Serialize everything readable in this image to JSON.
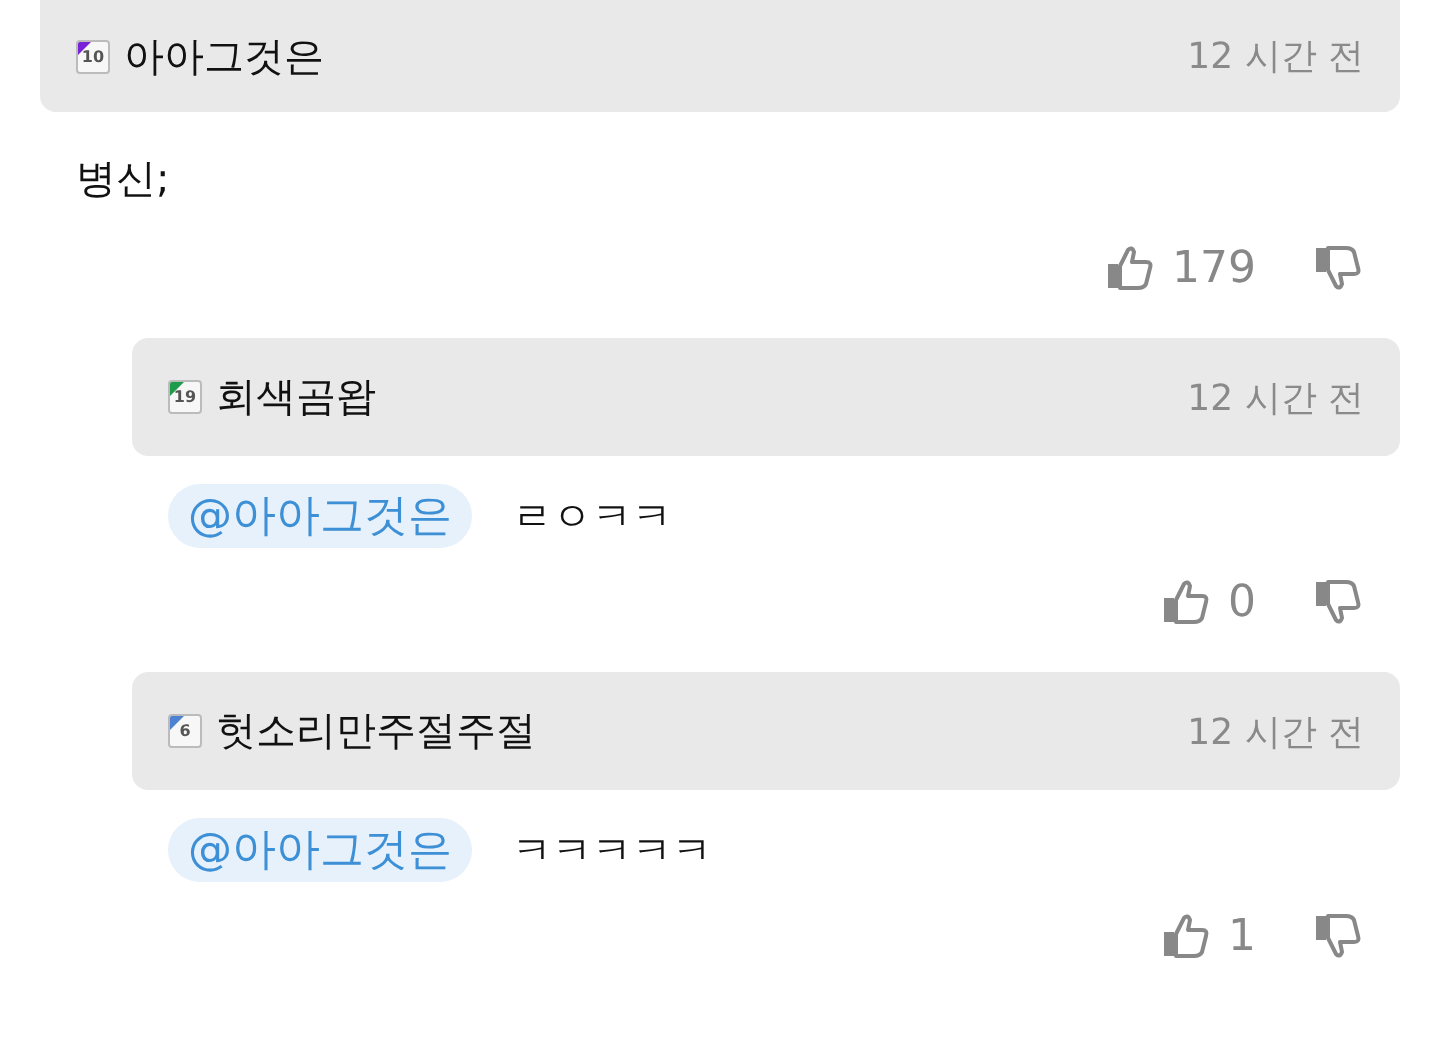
{
  "comments": [
    {
      "user": {
        "name": "아아그것은",
        "level": "10",
        "color": "#7a22d8"
      },
      "time": "12 시간 전",
      "text": "병신;",
      "likes": "179",
      "reply": false
    },
    {
      "user": {
        "name": "회색곰왑",
        "level": "19",
        "color": "#1d9a4c"
      },
      "time": "12 시간 전",
      "mention": "@아아그것은",
      "text": "ㄹㅇㅋㅋ",
      "likes": "0",
      "reply": true
    },
    {
      "user": {
        "name": "헛소리만주절주절",
        "level": "6",
        "color": "#4d82d2"
      },
      "time": "12 시간 전",
      "mention": "@아아그것은",
      "text": "ㅋㅋㅋㅋㅋ",
      "likes": "1",
      "reply": true
    }
  ]
}
